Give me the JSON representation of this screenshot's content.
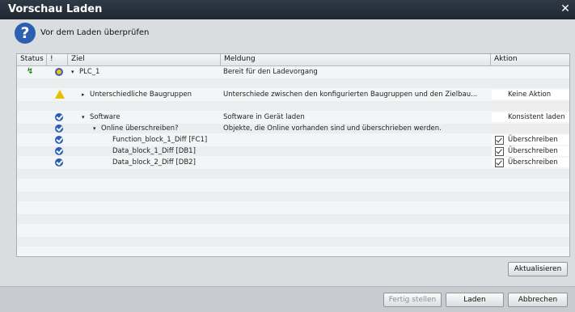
{
  "window": {
    "title": "Vorschau Laden",
    "close_glyph": "✕"
  },
  "header": {
    "icon": "question-icon",
    "icon_glyph": "?",
    "text": "Vor dem Laden überprüfen"
  },
  "columns": [
    "Status",
    "!",
    "Ziel",
    "Meldung",
    "Aktion"
  ],
  "rows": [
    {
      "status": "↯",
      "icon": "plc-icon",
      "expand": "▾",
      "target": "PLC_1",
      "message": "Bereit für den Ladevorgang",
      "action": ""
    },
    {
      "status": "",
      "icon": "",
      "expand": "",
      "target": "",
      "message": "",
      "action": ""
    },
    {
      "status": "",
      "icon": "warning-icon",
      "expand": "▸",
      "target": "Unterschiedliche Baugruppen",
      "message": "Unterschiede zwischen den konfigurierten Baugruppen und den Zielbau...",
      "action": "Keine Aktion"
    },
    {
      "status": "",
      "icon": "",
      "expand": "",
      "target": "",
      "message": "",
      "action": ""
    },
    {
      "status": "",
      "icon": "check-icon",
      "expand": "▾",
      "target": "Software",
      "message": "Software in Gerät laden",
      "action": "Konsistent laden"
    },
    {
      "status": "",
      "icon": "check-icon",
      "expand": "▾",
      "target": "Online überschreiben?",
      "message": "Objekte, die Online vorhanden sind und überschrieben werden.",
      "action": ""
    },
    {
      "status": "",
      "icon": "check-icon",
      "expand": "",
      "target": "Function_block_1_Diff [FC1]",
      "message": "",
      "action": "Überschreiben",
      "checked": true
    },
    {
      "status": "",
      "icon": "check-icon",
      "expand": "",
      "target": "Data_block_1_Diff [DB1]",
      "message": "",
      "action": "Überschreiben",
      "checked": true
    },
    {
      "status": "",
      "icon": "check-icon",
      "expand": "",
      "target": "Data_block_2_Diff [DB2]",
      "message": "",
      "action": "Überschreiben",
      "checked": true
    }
  ],
  "buttons": {
    "refresh": "Aktualisieren",
    "finish": "Fertig stellen",
    "load": "Laden",
    "cancel": "Abbrechen"
  }
}
